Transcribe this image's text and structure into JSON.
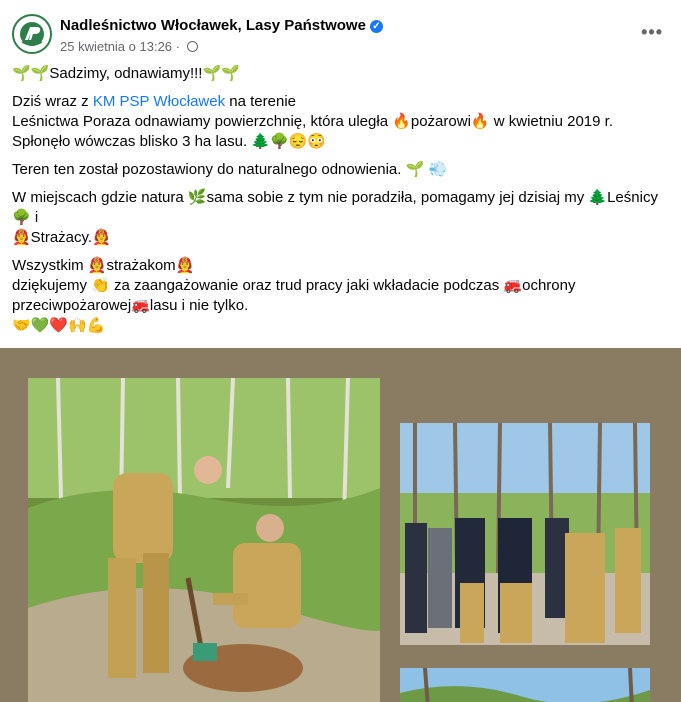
{
  "post": {
    "author": "Nadleśnictwo Włocławek, Lasy Państwowe",
    "timestamp": "25 kwietnia o 13:26",
    "separator": "·",
    "more": "•••",
    "lines": {
      "l1": "🌱🌱Sadzimy, odnawiamy!!!🌱🌱",
      "l2a": "Dziś wraz z ",
      "l2link": "KM PSP Włocławek",
      "l2b": " na terenie",
      "l3": "Leśnictwa Poraza  odnawiamy powierzchnię, która uległa 🔥pożarowi🔥 w kwietniu 2019 r.",
      "l4": "Spłonęło wówczas blisko 3 ha lasu. 🌲🌳😔😳",
      "l5": "Teren ten został pozostawiony do naturalnego odnowienia. 🌱 💨",
      "l6": "W miejscach gdzie natura 🌿sama sobie z tym nie poradziła, pomagamy jej dzisiaj my 🌲Leśnicy🌳 i",
      "l7": "🧑‍🚒Strażacy.🧑‍🚒",
      "l8": "Wszystkim 🧑‍🚒strażakom🧑‍🚒",
      "l9": "dziękujemy 👏 za zaangażowanie oraz trud pracy jaki wkładacie podczas 🚒ochrony",
      "l10": "przeciwpożarowej🚒lasu i nie tylko.",
      "l11": "🤝💚❤️🙌💪"
    }
  },
  "colors": {
    "link": "#1877f2",
    "photo_background": "#8a7c62",
    "uniform": "#c9a65a"
  },
  "icons": {
    "verified": "verified-badge-icon",
    "globe": "globe-icon",
    "more": "more-options-icon"
  }
}
